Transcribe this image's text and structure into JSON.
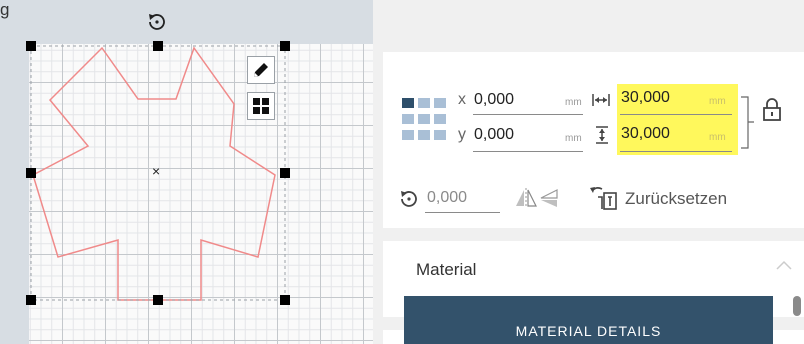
{
  "canvas": {
    "top_text": "g",
    "shape_stroke_color": "#f08a8a",
    "handle_color": "#000000",
    "center_marker": "×",
    "icons": {
      "rotate": "rotate-icon",
      "edit": "pencil-icon",
      "grid": "grid-icon"
    }
  },
  "transform": {
    "x_label": "x",
    "x_value": "0,000",
    "x_unit": "mm",
    "y_label": "y",
    "y_value": "0,000",
    "y_unit": "mm",
    "width_value": "30,000",
    "width_unit": "mm",
    "height_value": "30,000",
    "height_unit": "mm",
    "highlight_color": "#fff85c",
    "rotation_value": "0,000",
    "reset_label": "Zurücksetzen",
    "icons": {
      "anchor": "anchor-grid-icon",
      "width": "width-arrows-icon",
      "height": "height-arrows-icon",
      "lock": "lock-icon",
      "rotation": "rotate-icon",
      "flip_h": "flip-horizontal-icon",
      "flip_v": "flip-vertical-icon",
      "reset": "reset-icon"
    }
  },
  "material": {
    "title": "Material",
    "details_button": "MATERIAL DETAILS",
    "accent_color": "#33526b"
  }
}
